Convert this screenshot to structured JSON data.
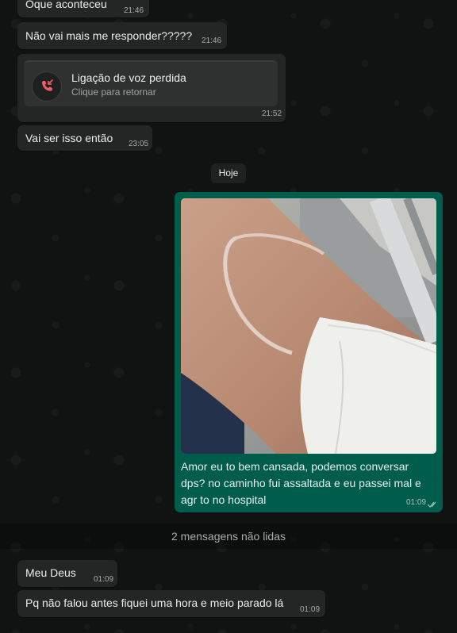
{
  "messages_before": [
    {
      "text": "Oque aconteceu",
      "time": "21:46"
    },
    {
      "text": "Não vai mais me responder?????",
      "time": "21:46"
    }
  ],
  "missed_call": {
    "title": "Ligação de voz perdida",
    "subtitle": "Clique para retornar",
    "time": "21:52",
    "icon": "missed-call-icon",
    "icon_color": "#f15c6d"
  },
  "message_after_call": {
    "text": "Vai ser isso então",
    "time": "23:05"
  },
  "date_divider": "Hoje",
  "outgoing": {
    "caption": "Amor eu to bem cansada, podemos conversar dps? no caminho fui assaltada e eu passei mal e agr to no hospital",
    "time": "01:09",
    "status_icon": "double-check-icon",
    "bubble_color": "#005c4b"
  },
  "unread_divider": "2 mensagens não lidas",
  "messages_after": [
    {
      "text": "Meu Deus",
      "time": "01:09"
    },
    {
      "text": "Pq não falou antes fiquei uma hora e meio parado lá",
      "time": "01:09"
    }
  ]
}
